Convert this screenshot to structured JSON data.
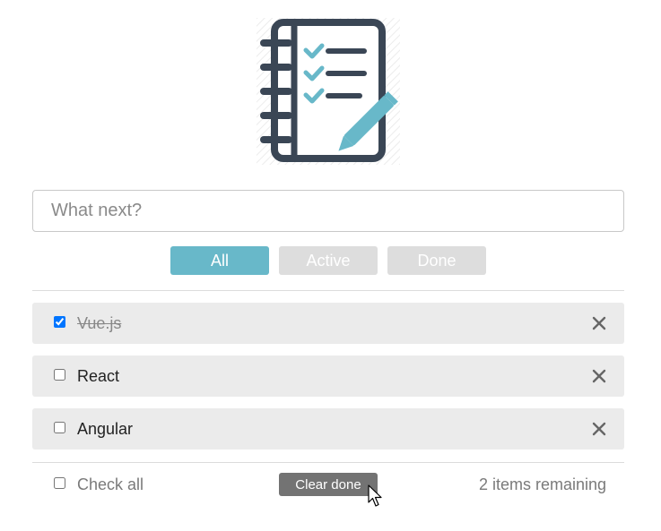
{
  "logo": {
    "icon": "notebook-checklist-icon",
    "accent_color": "#68b8c9",
    "line_color": "#3a4655"
  },
  "new_todo": {
    "placeholder": "What next?",
    "value": ""
  },
  "filters": [
    {
      "label": "All",
      "active": true
    },
    {
      "label": "Active",
      "active": false
    },
    {
      "label": "Done",
      "active": false
    }
  ],
  "todos": [
    {
      "label": "Vue.js",
      "done": true
    },
    {
      "label": "React",
      "done": false
    },
    {
      "label": "Angular",
      "done": false
    }
  ],
  "footer": {
    "check_all_label": "Check all",
    "check_all_checked": false,
    "clear_done_label": "Clear done",
    "remaining_text": "2 items remaining"
  },
  "colors": {
    "active_filter": "#68b8c9",
    "inactive_filter": "#dddddd",
    "item_background": "#ebebeb",
    "clear_done_background": "#737373"
  }
}
